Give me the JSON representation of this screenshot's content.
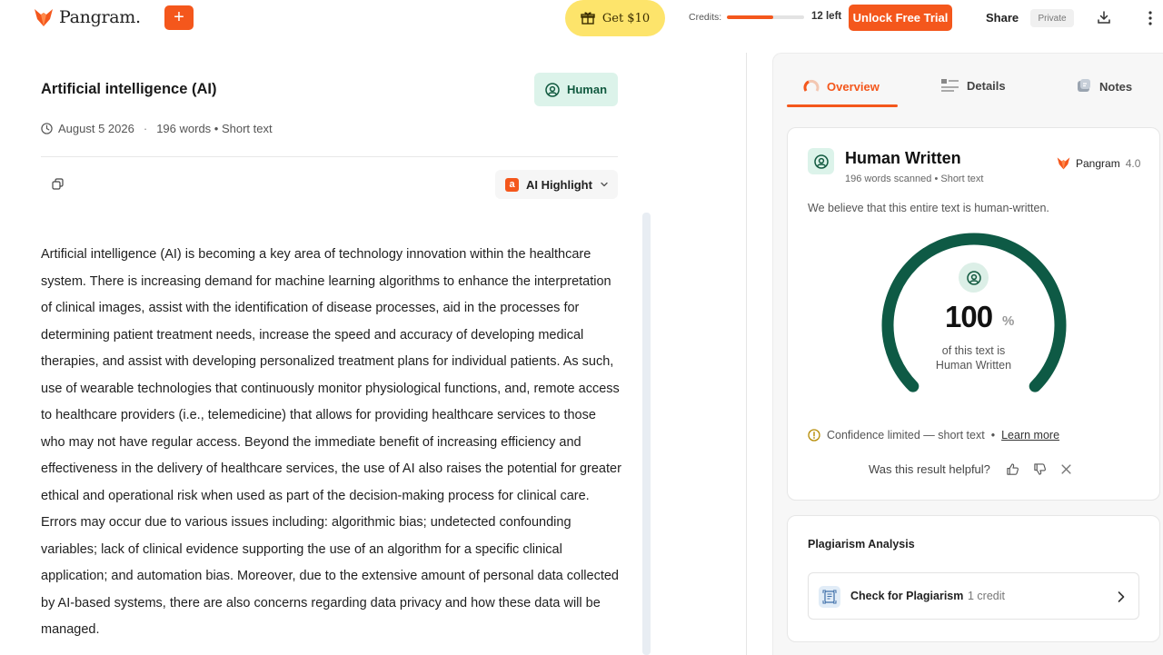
{
  "header": {
    "logo_text": "Pangram.",
    "new_button_label": "+",
    "promo_label": "Get $10",
    "credits_label": "Credits:",
    "credits_fraction": 0.6,
    "credits_left": "12 left",
    "unlock_label": "Unlock Free Trial",
    "share_label": "Share",
    "private_label": "Private"
  },
  "document": {
    "title": "Artificial intelligence (AI)",
    "badge_label": "Human",
    "date": "August 5 2026",
    "separator": "·",
    "word_info": "196 words • Short text",
    "highlight_icon_letter": "a",
    "highlight_label": "AI Highlight",
    "body": "Artificial intelligence (AI) is becoming a key area of technology innovation within the healthcare system. There is increasing demand for machine learning algorithms to enhance the interpretation of clinical images, assist with the identification of disease processes, aid in the processes for determining patient treatment needs, increase the speed and accuracy of developing medical therapies, and assist with developing personalized treatment plans for individual patients. As such, use of wearable technologies that continuously monitor physiological functions, and, remote access to healthcare providers (i.e., telemedicine) that allows for providing healthcare services to those who may not have regular access. Beyond the immediate benefit of increasing efficiency and effectiveness in the delivery of healthcare services, the use of AI also raises the potential for greater ethical and operational risk when used as part of the decision-making process for clinical care. Errors may occur due to various issues including: algorithmic bias; undetected confounding variables; lack of clinical evidence supporting the use of an algorithm for a specific clinical application; and automation bias. Moreover, due to the extensive amount of personal data collected by AI-based systems, there are also concerns regarding data privacy and how these data will be managed."
  },
  "panel": {
    "tabs": [
      {
        "label": "Overview",
        "active": true
      },
      {
        "label": "Details",
        "active": false
      },
      {
        "label": "Notes",
        "active": false
      }
    ],
    "result": {
      "title": "Human Written",
      "subtitle": "196 words scanned • Short text",
      "brand": "Pangram",
      "version": "4.0",
      "description": "We believe that this entire text is human-written.",
      "score": "100",
      "score_unit": "%",
      "score_fraction": 1.0,
      "caption_line1": "of this text is",
      "caption_line2": "Human Written",
      "confidence": "Confidence limited — short text",
      "confidence_sep": "•",
      "learn_more": "Learn more",
      "helpful_question": "Was this result helpful?"
    },
    "plagiarism": {
      "title": "Plagiarism Analysis",
      "button_label": "Check for Plagiarism",
      "credit_label": "1 credit"
    }
  },
  "colors": {
    "brand_orange": "#f4571c",
    "human_green": "#0e5a45",
    "human_bg": "#dcf3ea",
    "promo_yellow": "#fde46b"
  },
  "icons": {
    "logo": "fox-logo-icon",
    "promo": "gift-icon",
    "download": "download-icon",
    "more": "more-vertical-icon",
    "date": "clock-icon",
    "copy": "copy-icon",
    "chevron": "chevron-down-icon",
    "human": "user-circle-icon",
    "thumbs_up": "thumbs-up-icon",
    "thumbs_down": "thumbs-down-icon",
    "close": "close-icon",
    "info": "info-icon",
    "plagiarism": "document-scan-icon",
    "arrow": "chevron-right-icon"
  }
}
